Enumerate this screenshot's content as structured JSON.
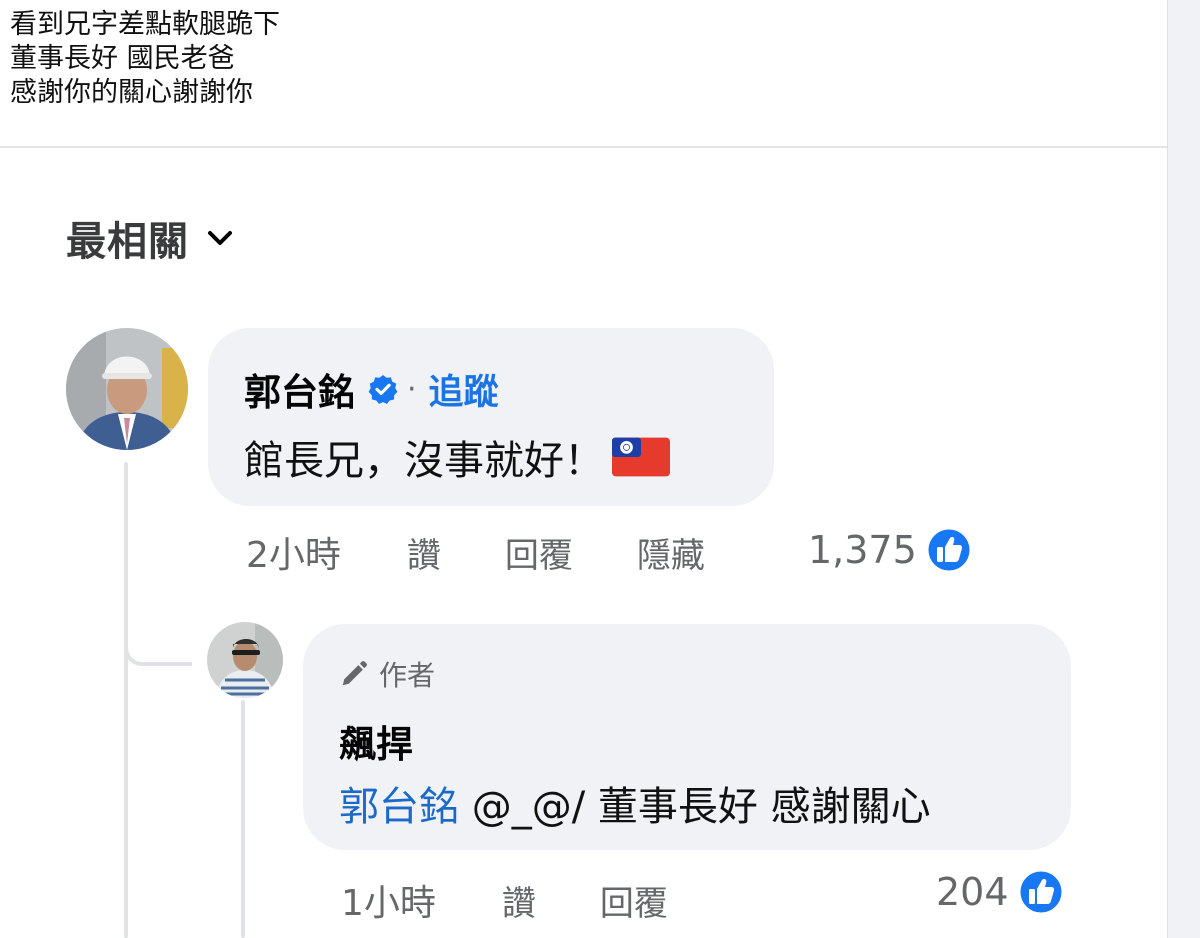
{
  "post": {
    "lines": [
      "看到兄字差點軟腿跪下",
      "董事長好 國民老爸",
      "感謝你的關心謝謝你"
    ]
  },
  "sort": {
    "label": "最相關",
    "icon": "chevron-down-icon"
  },
  "comment": {
    "author": "郭台銘",
    "verified_icon": "verified-badge-icon",
    "separator": "·",
    "follow_label": "追蹤",
    "text": "館長兄，沒事就好！",
    "emoji": "taiwan-flag-emoji",
    "time": "2小時",
    "like_label": "讚",
    "reply_label": "回覆",
    "hide_label": "隱藏",
    "reaction_count": "1,375",
    "reaction_icon": "like-icon"
  },
  "reply": {
    "badge_icon": "pen-icon",
    "badge_label": "作者",
    "author": "飆捍",
    "mention": "郭台銘",
    "text": " @_@/ 董事長好 感謝關心",
    "time": "1小時",
    "like_label": "讚",
    "reply_label": "回覆",
    "reaction_count": "204",
    "reaction_icon": "like-icon"
  },
  "colors": {
    "link": "#1b74e4",
    "bubble": "#f0f2f5",
    "secondary_text": "#65676b",
    "like_blue": "#1877f2"
  }
}
